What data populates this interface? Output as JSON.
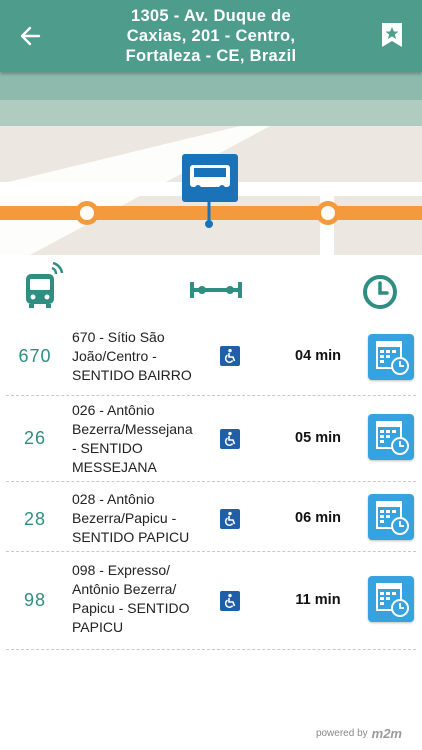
{
  "header": {
    "title_lines": [
      "1305 - Av. Duque de",
      "Caxias, 201 - Centro,",
      "Fortaleza - CE, Brazil"
    ],
    "back_icon": "arrow-left-icon",
    "favorite_icon": "bookmark-star-icon"
  },
  "map": {
    "stop_icon": "bus-stop-pin-icon",
    "route_color": "#f59a3c"
  },
  "icon_bar": {
    "line_icon": "bus-realtime-icon",
    "distance_icon": "distance-measure-icon",
    "time_icon": "clock-icon"
  },
  "arrivals": [
    {
      "line": "670",
      "name_lines": [
        "670 - Sítio São",
        "João/Centro -",
        "SENTIDO BAIRRO"
      ],
      "eta": "04 min",
      "accessible": true
    },
    {
      "line": "26",
      "name_lines": [
        "026 - Antônio",
        "Bezerra/Messejana",
        "- SENTIDO",
        "MESSEJANA"
      ],
      "eta": "05 min",
      "accessible": true
    },
    {
      "line": "28",
      "name_lines": [
        "028 - Antônio",
        "Bezerra/Papicu -",
        "SENTIDO  PAPICU"
      ],
      "eta": "06 min",
      "accessible": true
    },
    {
      "line": "98",
      "name_lines": [
        "098 - Expresso/",
        "Antônio Bezerra/",
        "Papicu - SENTIDO",
        "PAPICU"
      ],
      "eta": "11 min",
      "accessible": true
    }
  ],
  "footer": {
    "powered_by": "powered by",
    "brand": "m2m"
  },
  "colors": {
    "header": "#4e9c8c",
    "accent_teal": "#2f8e82",
    "schedule_button": "#36a3e0",
    "accessibility": "#1f5fa8"
  }
}
